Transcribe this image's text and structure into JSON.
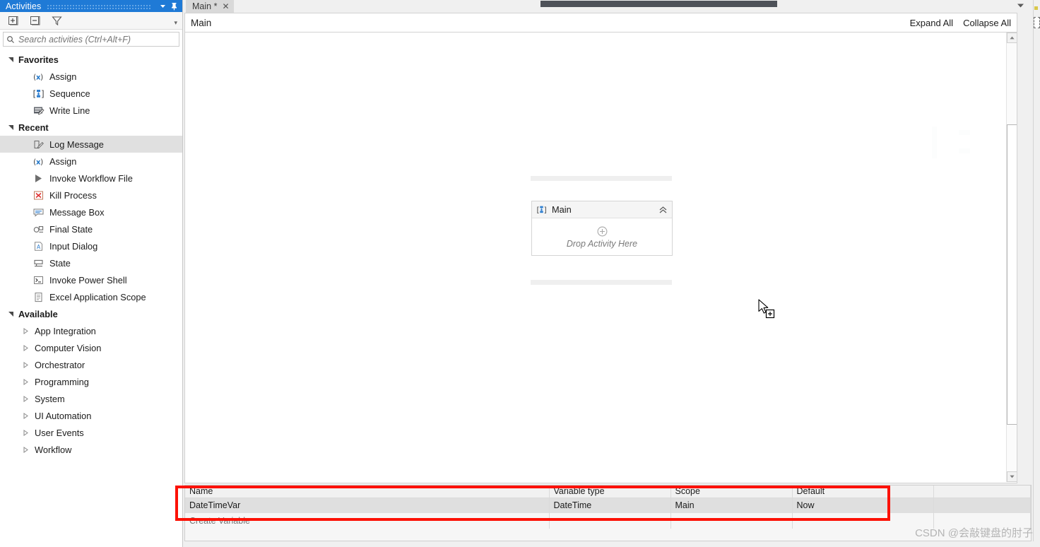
{
  "activities_panel": {
    "title": "Activities",
    "titlebar_icons": [
      "chevron-down-icon",
      "pin-icon"
    ],
    "toolbar": {
      "expand_all_icon": "expand-all-icon",
      "collapse_all_icon": "collapse-all-icon",
      "filter_icon": "filter-icon",
      "overflow_label": "▾"
    },
    "search": {
      "placeholder": "Search activities (Ctrl+Alt+F)",
      "value": "",
      "icon": "search-icon"
    },
    "groups": [
      {
        "label": "Favorites",
        "expanded": true,
        "items": [
          {
            "label": "Assign",
            "icon": "assign-icon",
            "selected": false
          },
          {
            "label": "Sequence",
            "icon": "sequence-icon",
            "selected": false
          },
          {
            "label": "Write Line",
            "icon": "write-line-icon",
            "selected": false
          }
        ]
      },
      {
        "label": "Recent",
        "expanded": true,
        "items": [
          {
            "label": "Log Message",
            "icon": "log-message-icon",
            "selected": true
          },
          {
            "label": "Assign",
            "icon": "assign-icon",
            "selected": false
          },
          {
            "label": "Invoke Workflow File",
            "icon": "invoke-workflow-icon",
            "selected": false
          },
          {
            "label": "Kill Process",
            "icon": "kill-process-icon",
            "selected": false
          },
          {
            "label": "Message Box",
            "icon": "message-box-icon",
            "selected": false
          },
          {
            "label": "Final State",
            "icon": "final-state-icon",
            "selected": false
          },
          {
            "label": "Input Dialog",
            "icon": "input-dialog-icon",
            "selected": false
          },
          {
            "label": "State",
            "icon": "state-icon",
            "selected": false
          },
          {
            "label": "Invoke Power Shell",
            "icon": "invoke-powershell-icon",
            "selected": false
          },
          {
            "label": "Excel Application Scope",
            "icon": "excel-scope-icon",
            "selected": false
          }
        ]
      },
      {
        "label": "Available",
        "expanded": true,
        "categories": [
          {
            "label": "App Integration"
          },
          {
            "label": "Computer Vision"
          },
          {
            "label": "Orchestrator"
          },
          {
            "label": "Programming"
          },
          {
            "label": "System"
          },
          {
            "label": "UI Automation"
          },
          {
            "label": "User Events"
          },
          {
            "label": "Workflow"
          }
        ]
      }
    ]
  },
  "tabs": [
    {
      "label": "Main *",
      "close_icon": "close-icon",
      "active": true
    }
  ],
  "designer": {
    "breadcrumb": "Main",
    "expand_all_label": "Expand All",
    "collapse_all_label": "Collapse All",
    "sequence": {
      "title": "Main",
      "icon": "sequence-icon",
      "collapse_icon": "chevron-up-double-icon",
      "drop_hint": "Drop Activity Here",
      "add_icon": "plus-circle-icon"
    },
    "cursor_icon": "drag-copy-cursor",
    "scrollbar": {
      "up_icon": "scroll-up-icon",
      "down_icon": "scroll-down-icon"
    }
  },
  "variables": {
    "columns": [
      "Name",
      "Variable type",
      "Scope",
      "Default"
    ],
    "rows": [
      {
        "name": "DateTimeVar",
        "type": "DateTime",
        "scope": "Main",
        "default": "Now"
      }
    ],
    "create_row_label": "Create Variable",
    "highlight_color": "#fc1105"
  },
  "watermark": "CSDN @会敲键盘的肘子"
}
